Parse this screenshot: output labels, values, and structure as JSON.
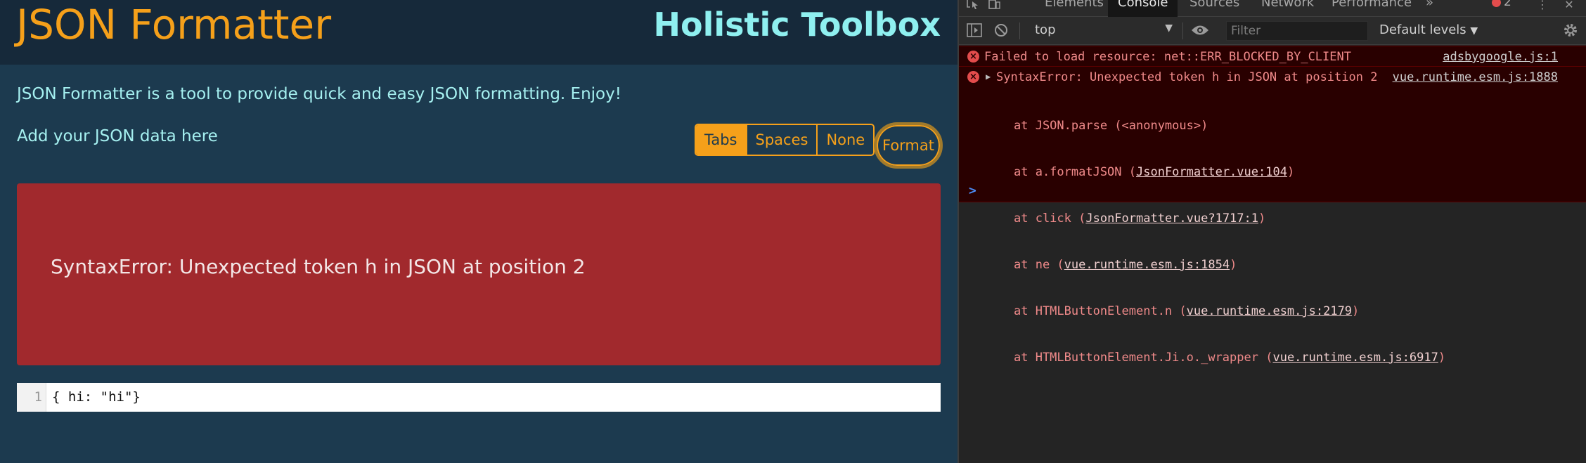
{
  "app": {
    "title": "JSON Formatter",
    "brand": "Holistic Toolbox",
    "intro": "JSON Formatter is a tool to provide quick and easy JSON formatting. Enjoy!",
    "input_label": "Add your JSON data here",
    "indent_options": [
      {
        "label": "Tabs",
        "active": true
      },
      {
        "label": "Spaces",
        "active": false
      },
      {
        "label": "None",
        "active": false
      }
    ],
    "format_label": "Format",
    "error_message": "SyntaxError: Unexpected token h in JSON at position 2",
    "editor": {
      "line_number": "1",
      "content": "{ hi: \"hi\"}"
    },
    "colors": {
      "accent": "#f5a01a",
      "brand": "#8ff0f0",
      "error": "#a1292d",
      "background": "#1c3a4f"
    }
  },
  "devtools": {
    "tabs": [
      "Elements",
      "Console",
      "Sources",
      "Network",
      "Performance"
    ],
    "active_tab": "Console",
    "more_tabs": "»",
    "error_count": "2",
    "context": "top",
    "filter_placeholder": "Filter",
    "levels": "Default levels",
    "messages": [
      {
        "text": "Failed to load resource: net::ERR_BLOCKED_BY_CLIENT",
        "source": "adsbygoogle.js:1"
      },
      {
        "text": "SyntaxError: Unexpected token h in JSON at position 2",
        "source": "vue.runtime.esm.js:1888",
        "stack": [
          {
            "prefix": "at JSON.parse (<anonymous>)",
            "link": "",
            "suffix": ""
          },
          {
            "prefix": "at a.formatJSON (",
            "link": "JsonFormatter.vue:104",
            "suffix": ")"
          },
          {
            "prefix": "at click (",
            "link": "JsonFormatter.vue?1717:1",
            "suffix": ")"
          },
          {
            "prefix": "at ne (",
            "link": "vue.runtime.esm.js:1854",
            "suffix": ")"
          },
          {
            "prefix": "at HTMLButtonElement.n (",
            "link": "vue.runtime.esm.js:2179",
            "suffix": ")"
          },
          {
            "prefix": "at HTMLButtonElement.Ji.o._wrapper (",
            "link": "vue.runtime.esm.js:6917",
            "suffix": ")"
          }
        ]
      }
    ],
    "prompt": ">"
  }
}
